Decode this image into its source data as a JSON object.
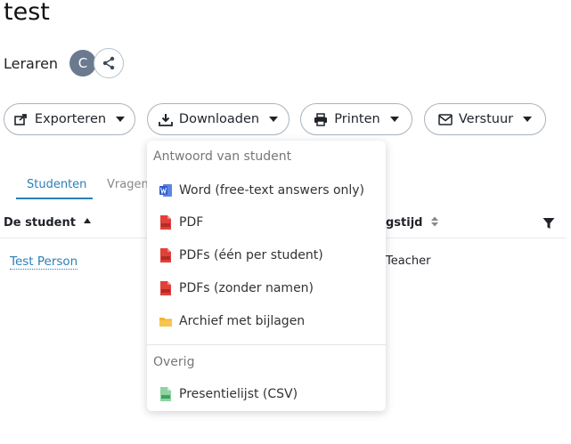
{
  "page": {
    "title": "test"
  },
  "teachers": {
    "label": "Leraren",
    "avatar_initial": "C"
  },
  "actions": {
    "export_label": "Exporteren",
    "download_label": "Downloaden",
    "print_label": "Printen",
    "send_label": "Verstuur"
  },
  "tabs": [
    {
      "label": "Studenten",
      "active": true
    },
    {
      "label": "Vragen",
      "active": false
    }
  ],
  "table": {
    "headers": {
      "student": "De student",
      "time": "gstijd"
    },
    "rows": [
      {
        "student": "Test Person",
        "role": "Teacher"
      }
    ]
  },
  "dropdown": {
    "section1": "Antwoord van student",
    "items1": [
      {
        "label": "Word (free-text answers only)",
        "icon": "word-icon"
      },
      {
        "label": "PDF",
        "icon": "pdf-icon"
      },
      {
        "label": "PDFs (één per student)",
        "icon": "pdf-icon"
      },
      {
        "label": "PDFs (zonder namen)",
        "icon": "pdf-icon"
      },
      {
        "label": "Archief met bijlagen",
        "icon": "folder-icon"
      }
    ],
    "section2": "Overig",
    "items2": [
      {
        "label": "Presentielijst (CSV)",
        "icon": "csv-icon"
      }
    ]
  },
  "colors": {
    "accent": "#2b7fb8",
    "pdf": "#e2403b",
    "word": "#2f5bd3",
    "folder": "#f3b431",
    "csv": "#3aa55d"
  }
}
